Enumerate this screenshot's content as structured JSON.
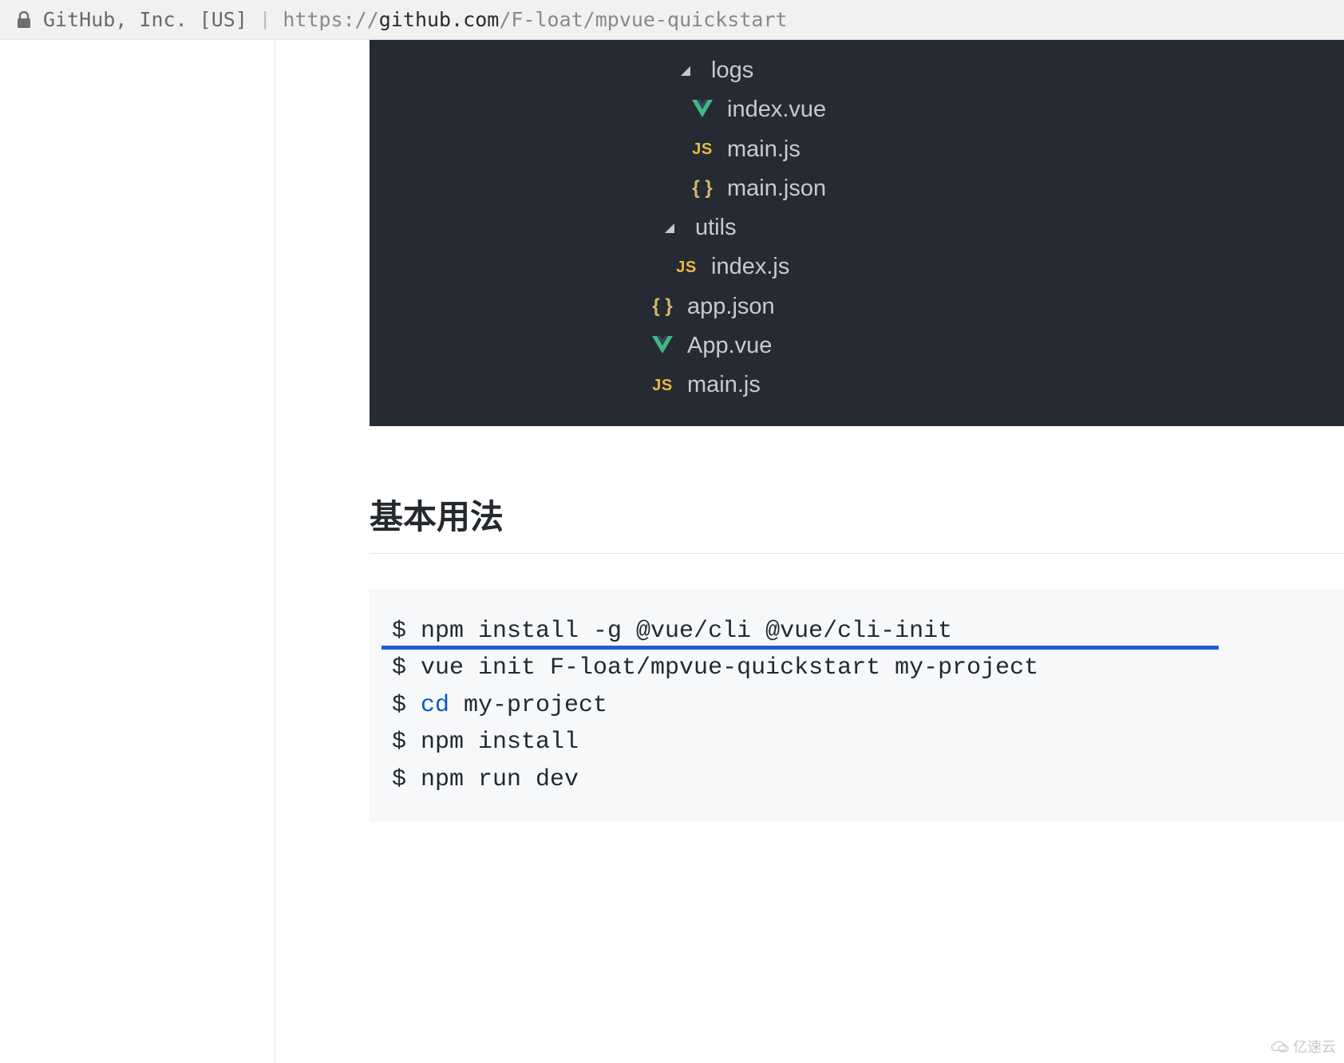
{
  "urlBar": {
    "label": "GitHub, Inc. [US]",
    "protocol": "https://",
    "domain": "github.com",
    "path": "/F-loat/mpvue-quickstart"
  },
  "fileTree": {
    "items": [
      {
        "type": "folder",
        "name": "logs",
        "level": "folder-logs"
      },
      {
        "type": "vue",
        "name": "index.vue",
        "level": "file-in-logs"
      },
      {
        "type": "js",
        "name": "main.js",
        "level": "file-in-logs"
      },
      {
        "type": "json",
        "name": "main.json",
        "level": "file-in-logs"
      },
      {
        "type": "folder",
        "name": "utils",
        "level": "folder-utils"
      },
      {
        "type": "js",
        "name": "index.js",
        "level": "file-in-utils"
      },
      {
        "type": "json",
        "name": "app.json",
        "level": "file-root"
      },
      {
        "type": "vue",
        "name": "App.vue",
        "level": "file-root"
      },
      {
        "type": "js",
        "name": "main.js",
        "level": "file-root"
      }
    ]
  },
  "heading": "基本用法",
  "code": {
    "lines": [
      {
        "prompt": "$ ",
        "text": "npm install -g @vue/cli @vue/cli-init",
        "keyword": ""
      },
      {
        "prompt": "$ ",
        "text": "vue init F-loat/mpvue-quickstart my-project",
        "keyword": ""
      },
      {
        "prompt": "$ ",
        "text": " my-project",
        "keyword": "cd"
      },
      {
        "prompt": "$ ",
        "text": "npm install",
        "keyword": ""
      },
      {
        "prompt": "$ ",
        "text": "npm run dev",
        "keyword": ""
      }
    ]
  },
  "watermark": "亿速云"
}
